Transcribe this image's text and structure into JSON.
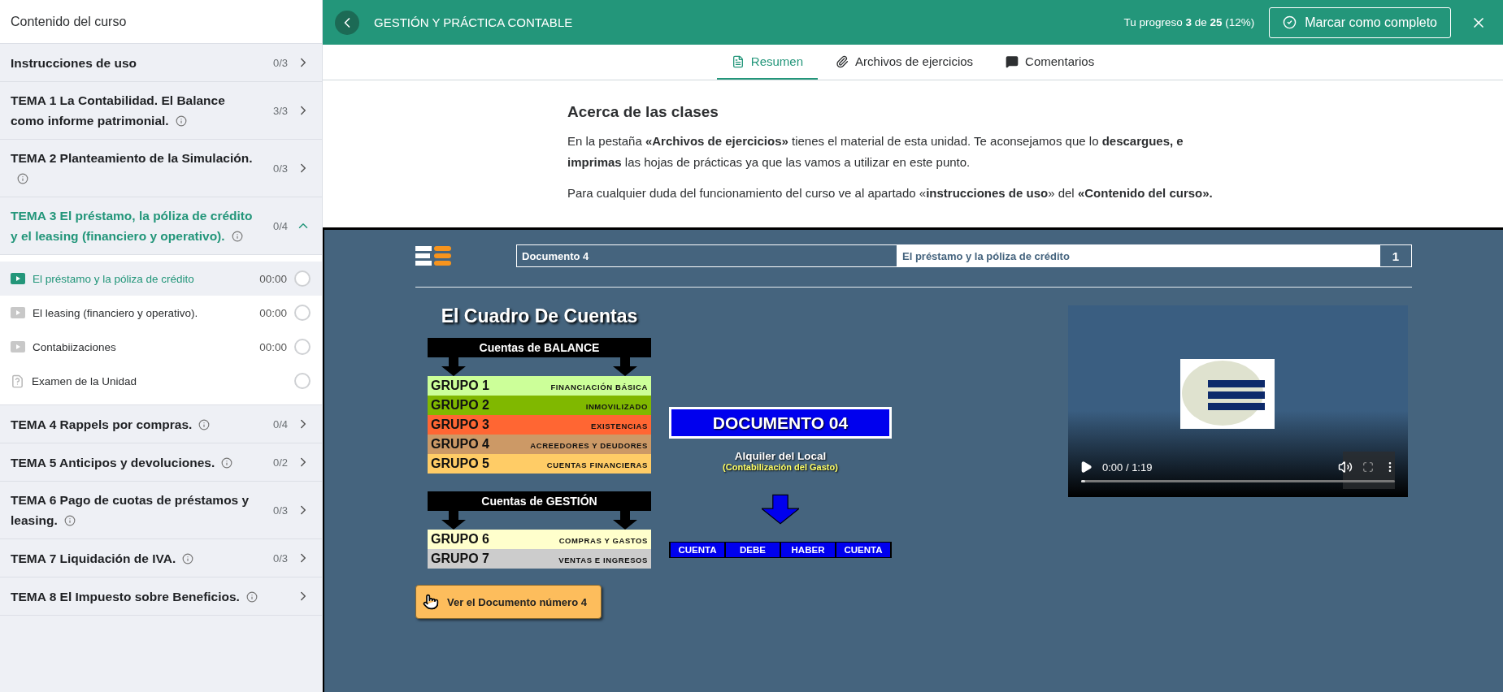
{
  "sidebar": {
    "title": "Contenido del curso",
    "sections": [
      {
        "title": "Instrucciones de uso",
        "count": "0/3",
        "info": false,
        "expanded": false
      },
      {
        "title": "TEMA 1 La Contabilidad. El Balance como informe patrimonial.",
        "count": "3/3",
        "info": true,
        "expanded": false
      },
      {
        "title": "TEMA 2 Planteamiento de la Simulación.",
        "count": "0/3",
        "info": true,
        "expanded": false
      },
      {
        "title": "TEMA 3 El préstamo, la póliza de crédito y el leasing (financiero y operativo).",
        "count": "0/4",
        "info": true,
        "expanded": true,
        "lessons": [
          {
            "title": "El préstamo y la póliza de crédito",
            "duration": "00:00",
            "kind": "video",
            "selected": true,
            "completed": false
          },
          {
            "title": "El leasing (financiero y operativo).",
            "duration": "00:00",
            "kind": "video",
            "selected": false,
            "completed": false
          },
          {
            "title": "Contabiizaciones",
            "duration": "00:00",
            "kind": "video",
            "selected": false,
            "completed": false
          },
          {
            "title": "Examen de la Unidad",
            "kind": "exam",
            "selected": false,
            "completed": false
          }
        ]
      },
      {
        "title": "TEMA 4 Rappels por compras.",
        "count": "0/4",
        "info": true,
        "expanded": false
      },
      {
        "title": "TEMA 5 Anticipos y devoluciones.",
        "count": "0/2",
        "info": true,
        "expanded": false
      },
      {
        "title": "TEMA 6 Pago de cuotas de préstamos y leasing.",
        "count": "0/3",
        "info": true,
        "expanded": false
      },
      {
        "title": "TEMA 7 Liquidación de IVA.",
        "count": "0/3",
        "info": true,
        "expanded": false
      },
      {
        "title": "TEMA 8 El Impuesto sobre Beneficios.",
        "info": true,
        "expanded": false
      }
    ]
  },
  "header": {
    "title": "GESTIÓN Y PRÁCTICA CONTABLE",
    "progress": "Tu progreso **3** de **25** (12%)",
    "complete_button": "Marcar como completo"
  },
  "tabs": [
    {
      "label": "Resumen",
      "kind": "summary",
      "selected": true
    },
    {
      "label": "Archivos de ejercicios",
      "kind": "files",
      "selected": false
    },
    {
      "label": "Comentarios",
      "kind": "comments",
      "selected": false
    }
  ],
  "about": {
    "heading": "Acerca de las clases",
    "paragraphs": [
      "En la pestaña **«Archivos de ejercicios»** tienes el material de esta unidad. Te aconsejamos que lo **descargues, e imprimas** las hojas de prácticas ya que las vamos a utilizar en este punto.",
      "Para cualquier duda del funcionamiento del curso ve al apartado «**instrucciones de uso**» del **«Contenido del curso».**"
    ]
  },
  "slide": {
    "doc_label": "Documento 4",
    "doc_title": "El préstamo y la póliza de crédito",
    "page": "1",
    "chart_title": "El Cuadro De Cuentas",
    "blocks": [
      {
        "heading": "Cuentas de BALANCE",
        "groups": [
          {
            "name": "GRUPO 1",
            "label": "FINANCIACIÓN BÁSICA",
            "color": "#ccff99"
          },
          {
            "name": "GRUPO 2",
            "label": "INMOVILIZADO",
            "color": "#80b800"
          },
          {
            "name": "GRUPO 3",
            "label": "EXISTENCIAS",
            "color": "#ff6633"
          },
          {
            "name": "GRUPO 4",
            "label": "ACREEDORES Y DEUDORES",
            "color": "#cc9966"
          },
          {
            "name": "GRUPO 5",
            "label": "CUENTAS FINANCIERAS",
            "color": "#ffcc66"
          }
        ]
      },
      {
        "heading": "Cuentas de GESTIÓN",
        "groups": [
          {
            "name": "GRUPO 6",
            "label": "COMPRAS Y GASTOS",
            "color": "#ffffcc"
          },
          {
            "name": "GRUPO 7",
            "label": "VENTAS E INGRESOS",
            "color": "#cccccc"
          }
        ]
      }
    ],
    "button": "Ver el Documento número 4",
    "doc_badge": "DOCUMENTO 04",
    "doc_subtitle": "Alquiler del Local",
    "doc_note": "(Contabilización del Gasto)",
    "entry_columns": [
      "CUENTA",
      "DEBE",
      "HABER",
      "CUENTA"
    ],
    "video": {
      "time": "0:00 / 1:19",
      "level": 0
    }
  }
}
